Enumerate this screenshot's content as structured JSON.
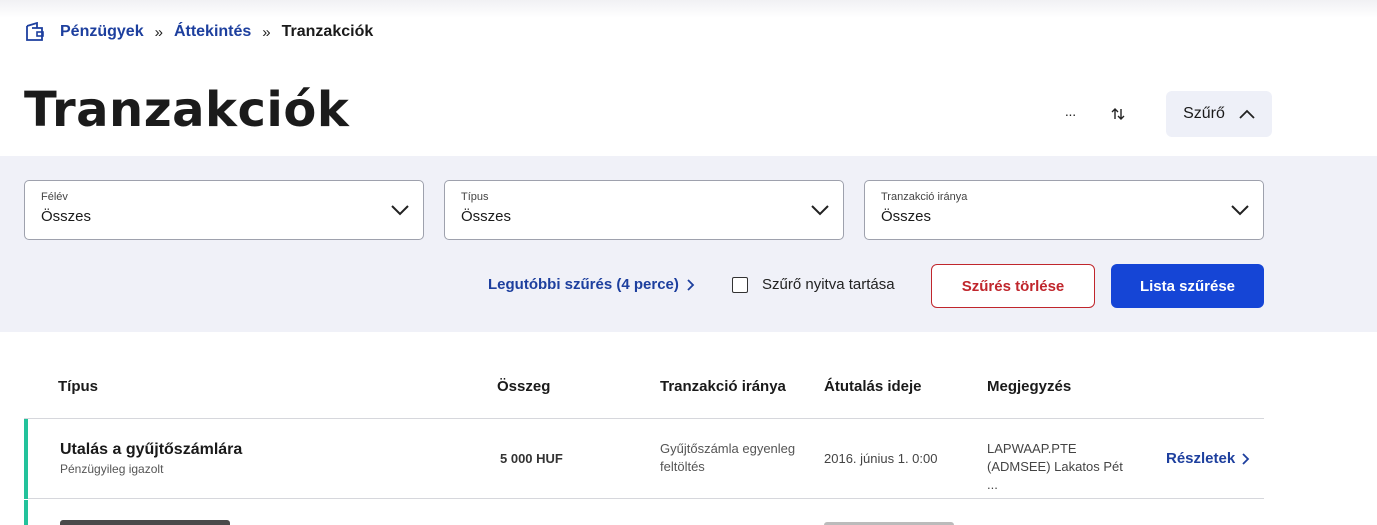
{
  "breadcrumb": {
    "items": [
      "Pénzügyek",
      "Áttekintés"
    ],
    "current": "Tranzakciók",
    "separator": "»"
  },
  "page": {
    "title": "Tranzakciók"
  },
  "header_actions": {
    "more_label": "···",
    "filter_label": "Szűrő"
  },
  "filters": {
    "semester": {
      "label": "Félév",
      "value": "Összes"
    },
    "type": {
      "label": "Típus",
      "value": "Összes"
    },
    "direction": {
      "label": "Tranzakció iránya",
      "value": "Összes"
    },
    "recent_link": "Legutóbbi szűrés (4 perce)",
    "keep_open_label": "Szűrő nyitva tartása",
    "keep_open_checked": false,
    "clear_label": "Szűrés törlése",
    "apply_label": "Lista szűrése"
  },
  "table": {
    "columns": [
      "Típus",
      "Összeg",
      "Tranzakció iránya",
      "Átutalás ideje",
      "Megjegyzés"
    ],
    "rows": [
      {
        "type_title": "Utalás a gyűjtőszámlára",
        "type_sub": "Pénzügyileg igazolt",
        "amount": "5 000 HUF",
        "direction": "Gyűjtőszámla egyenleg feltöltés",
        "date": "2016. június 1. 0:00",
        "note": "LAPWAAP.PTE (ADMSEE) Lakatos Pét ...",
        "details_label": "Részletek",
        "status_color": "#23c29b"
      }
    ]
  },
  "colors": {
    "link": "#1d3f9e",
    "primary_button": "#1545d6",
    "danger": "#c0262c",
    "panel_bg": "#f0f1f8",
    "status_accent": "#23c29b"
  },
  "icons": {
    "breadcrumb": "wallet-icon",
    "more": "more-horizontal-icon",
    "sort": "sort-arrows-icon",
    "filter_toggle": "chevron-up-icon",
    "select": "chevron-down-icon",
    "link": "chevron-right-icon"
  }
}
